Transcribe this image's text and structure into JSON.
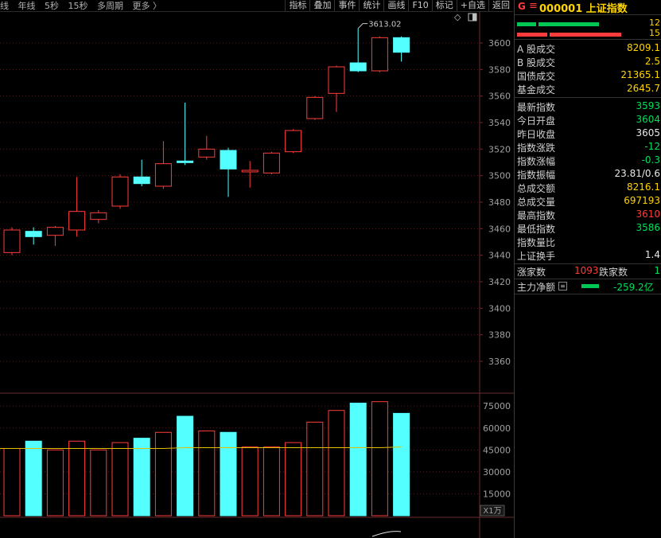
{
  "toolbar": {
    "left_items": [
      "线",
      "年线",
      "5秒",
      "15秒",
      "多周期",
      "更多 〉"
    ],
    "right_items": [
      "指标",
      "叠加",
      "事件",
      "统计",
      "画线",
      "F10",
      "标记",
      "+自选",
      "返回"
    ]
  },
  "panel": {
    "header": {
      "g_label": "G",
      "menu_icon": "menu-icon",
      "code_title": "000001 上证指数"
    },
    "ratio_bars": [
      {
        "value_label": "12",
        "color": "#00c853"
      },
      {
        "value_label": "15",
        "color": "#ff3b3b"
      }
    ],
    "turnover_rows": [
      {
        "label": "A 股成交",
        "value": "8209.1"
      },
      {
        "label": "B 股成交",
        "value": "2.5"
      },
      {
        "label": "国债成交",
        "value": "21365.1"
      },
      {
        "label": "基金成交",
        "value": "2645.7"
      }
    ],
    "quote_rows": [
      {
        "label": "最新指数",
        "value": "3593",
        "color": "green"
      },
      {
        "label": "今日开盘",
        "value": "3604",
        "color": "green"
      },
      {
        "label": "昨日收盘",
        "value": "3605",
        "color": "white"
      },
      {
        "label": "指数涨跌",
        "value": "-12",
        "color": "green"
      },
      {
        "label": "指数涨幅",
        "value": "-0.3",
        "color": "green"
      },
      {
        "label": "指数振幅",
        "value": "23.81/0.6",
        "color": "white"
      },
      {
        "label": "总成交额",
        "value": "8216.1",
        "color": "yellow"
      },
      {
        "label": "总成交量",
        "value": "697193",
        "color": "yellow"
      },
      {
        "label": "最高指数",
        "value": "3610",
        "color": "red"
      },
      {
        "label": "最低指数",
        "value": "3586",
        "color": "green"
      },
      {
        "label": "指数量比",
        "value": "",
        "color": "white"
      },
      {
        "label": "上证换手",
        "value": "1.4",
        "color": "white"
      }
    ],
    "advance_decline": {
      "up_label": "涨家数",
      "up_value": "1093",
      "down_label": "跌家数",
      "down_value": "1"
    },
    "main_flow": {
      "label": "主力净额",
      "value": "-259.2亿"
    }
  },
  "chart_data": {
    "type": "candlestick",
    "price_axis": {
      "min": 3340,
      "max": 3620,
      "ticks": [
        3360,
        3380,
        3400,
        3420,
        3440,
        3460,
        3480,
        3500,
        3520,
        3540,
        3560,
        3580,
        3600
      ]
    },
    "volume_axis": {
      "min": 0,
      "max": 80000,
      "ticks": [
        15000,
        30000,
        45000,
        60000,
        75000
      ],
      "unit_label": "X1万"
    },
    "max_annotation": "3613.02",
    "candles": [
      {
        "o": 3442,
        "c": 3459,
        "h": 3461,
        "l": 3440,
        "v": 46000,
        "dir": "up"
      },
      {
        "o": 3458,
        "c": 3454,
        "h": 3461,
        "l": 3448,
        "v": 51000,
        "dir": "down"
      },
      {
        "o": 3455,
        "c": 3461,
        "h": 3462,
        "l": 3447,
        "v": 45000,
        "dir": "up"
      },
      {
        "o": 3459,
        "c": 3473,
        "h": 3499,
        "l": 3454,
        "v": 51000,
        "dir": "up"
      },
      {
        "o": 3467,
        "c": 3472,
        "h": 3474,
        "l": 3464,
        "v": 45000,
        "dir": "up"
      },
      {
        "o": 3477,
        "c": 3499,
        "h": 3501,
        "l": 3475,
        "v": 50000,
        "dir": "up"
      },
      {
        "o": 3499,
        "c": 3494,
        "h": 3512,
        "l": 3492,
        "v": 53000,
        "dir": "down"
      },
      {
        "o": 3492,
        "c": 3509,
        "h": 3526,
        "l": 3490,
        "v": 57000,
        "dir": "up"
      },
      {
        "o": 3511,
        "c": 3510,
        "h": 3555,
        "l": 3508,
        "v": 68000,
        "dir": "down"
      },
      {
        "o": 3514,
        "c": 3520,
        "h": 3530,
        "l": 3512,
        "v": 58000,
        "dir": "up"
      },
      {
        "o": 3519,
        "c": 3505,
        "h": 3521,
        "l": 3484,
        "v": 57000,
        "dir": "down"
      },
      {
        "o": 3503,
        "c": 3504,
        "h": 3511,
        "l": 3491,
        "v": 47000,
        "dir": "up"
      },
      {
        "o": 3502,
        "c": 3517,
        "h": 3518,
        "l": 3501,
        "v": 47000,
        "dir": "up"
      },
      {
        "o": 3518,
        "c": 3534,
        "h": 3535,
        "l": 3517,
        "v": 50000,
        "dir": "up"
      },
      {
        "o": 3543,
        "c": 3559,
        "h": 3560,
        "l": 3542,
        "v": 64000,
        "dir": "up"
      },
      {
        "o": 3562,
        "c": 3582,
        "h": 3583,
        "l": 3548,
        "v": 72000,
        "dir": "up"
      },
      {
        "o": 3585,
        "c": 3579,
        "h": 3611,
        "l": 3578,
        "v": 77000,
        "dir": "down"
      },
      {
        "o": 3579,
        "c": 3604,
        "h": 3605,
        "l": 3578,
        "v": 78000,
        "dir": "up"
      },
      {
        "o": 3604,
        "c": 3593,
        "h": 3605,
        "l": 3586,
        "v": 70000,
        "dir": "down"
      }
    ],
    "volume_ma": [
      46000,
      46000,
      46000,
      46000,
      46000,
      46000,
      46000,
      46000,
      46500,
      46500,
      46500,
      46500,
      46500,
      46500,
      46500,
      46500,
      46500,
      46500,
      47000
    ],
    "grid": true,
    "colors": {
      "up": "#ff3b3b",
      "down": "#54ffff",
      "ma": "#e0c000",
      "axis_text": "#a0a0a0",
      "grid": "#4a2020"
    }
  }
}
